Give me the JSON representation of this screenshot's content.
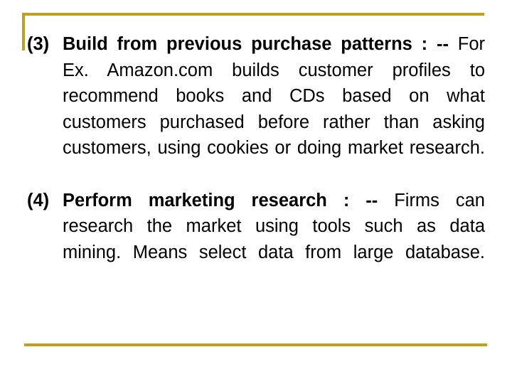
{
  "slide": {
    "accent_color": "#bfa122",
    "text_color": "#000000",
    "background_color": "#ffffff",
    "decorations": {
      "top_rule": "horizontal-gold-rule",
      "left_rule": "vertical-gold-rule",
      "bottom_rule": "horizontal-gold-rule"
    },
    "items": [
      {
        "marker": "(3)",
        "lead": "Build from previous purchase patterns : --",
        "body": " For Ex. Amazon.com builds customer profiles to recommend books and CDs based on what customers purchased before rather than asking customers, using cookies or doing market research."
      },
      {
        "marker": "(4)",
        "lead": "Perform marketing research : --",
        "body": " Firms can research the market using tools such as data mining. Means select data from large database."
      }
    ]
  }
}
